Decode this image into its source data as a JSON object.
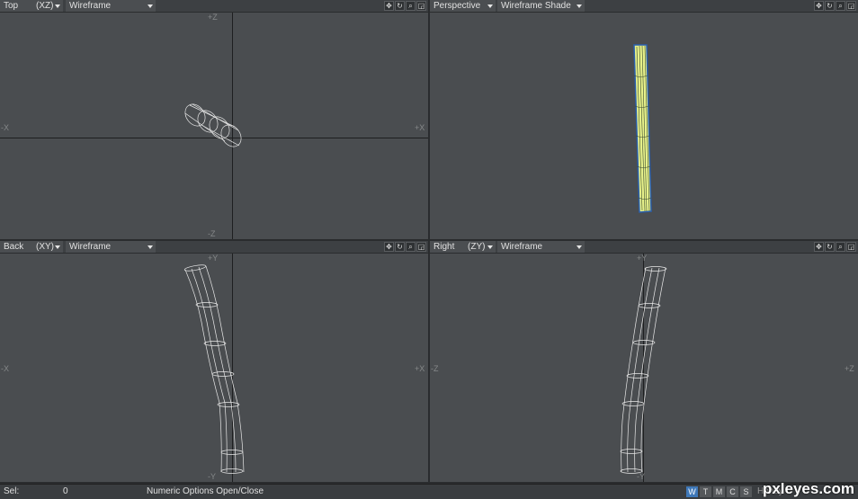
{
  "viewports": {
    "top": {
      "view": "Top",
      "axes": "(XZ)",
      "mode": "Wireframe",
      "labels": {
        "top": "+Z",
        "bottom": "-Z",
        "left": "-X",
        "right": "+X"
      }
    },
    "persp": {
      "view": "Perspective",
      "mode": "Wireframe Shade"
    },
    "back": {
      "view": "Back",
      "axes": "(XY)",
      "mode": "Wireframe",
      "labels": {
        "top": "+Y",
        "bottom": "-Y",
        "left": "-X",
        "right": "+X"
      }
    },
    "right": {
      "view": "Right",
      "axes": "(ZY)",
      "mode": "Wireframe",
      "labels": {
        "top": "+Y",
        "bottom": "-Y",
        "left": "-Z",
        "right": "+Z"
      }
    }
  },
  "header_icons": [
    "move-view-icon",
    "rotate-view-icon",
    "zoom-view-icon",
    "maximize-view-icon"
  ],
  "status": {
    "sel_label": "Sel:",
    "sel_value": "0",
    "message": "Numeric Options Open/Close",
    "modes": [
      "W",
      "T",
      "M",
      "C",
      "S"
    ],
    "active_mode": "W",
    "partial_label": "Honey"
  },
  "watermark": "pxleyes.com",
  "colors": {
    "viewport_bg": "#4a4d50",
    "header_bg": "#3d4043",
    "wire": "#e8e8e8",
    "shade": "#e6f08a",
    "shade_edge": "#2a60b0",
    "active_mode": "#3f78b8"
  }
}
